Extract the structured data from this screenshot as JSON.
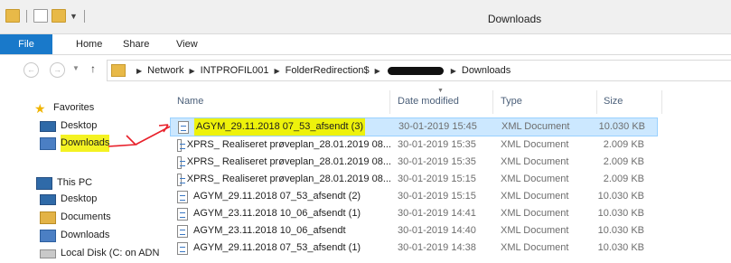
{
  "window": {
    "title": "Downloads"
  },
  "ribbon": {
    "tabs": [
      "File",
      "Home",
      "Share",
      "View"
    ]
  },
  "address": {
    "crumbs": [
      "Network",
      "INTPROFIL001",
      "FolderRedirection$",
      "Downloads"
    ]
  },
  "nav": {
    "favorites": "Favorites",
    "desktop": "Desktop",
    "downloads": "Downloads",
    "this_pc": "This PC",
    "pc_desktop": "Desktop",
    "pc_documents": "Documents",
    "pc_downloads": "Downloads",
    "local_disk": "Local Disk (C: on ADN"
  },
  "columns": {
    "name": "Name",
    "date": "Date modified",
    "type": "Type",
    "size": "Size"
  },
  "files": [
    {
      "name": "AGYM_29.11.2018 07_53_afsendt (3)",
      "date": "30-01-2019 15:45",
      "type": "XML Document",
      "size": "10.030 KB"
    },
    {
      "name": "XPRS_ Realiseret prøveplan_28.01.2019 08...",
      "date": "30-01-2019 15:35",
      "type": "XML Document",
      "size": "2.009 KB"
    },
    {
      "name": "XPRS_ Realiseret prøveplan_28.01.2019 08...",
      "date": "30-01-2019 15:35",
      "type": "XML Document",
      "size": "2.009 KB"
    },
    {
      "name": "XPRS_ Realiseret prøveplan_28.01.2019 08...",
      "date": "30-01-2019 15:15",
      "type": "XML Document",
      "size": "2.009 KB"
    },
    {
      "name": "AGYM_29.11.2018 07_53_afsendt (2)",
      "date": "30-01-2019 15:15",
      "type": "XML Document",
      "size": "10.030 KB"
    },
    {
      "name": "AGYM_23.11.2018 10_06_afsendt (1)",
      "date": "30-01-2019 14:41",
      "type": "XML Document",
      "size": "10.030 KB"
    },
    {
      "name": "AGYM_23.11.2018 10_06_afsendt",
      "date": "30-01-2019 14:40",
      "type": "XML Document",
      "size": "10.030 KB"
    },
    {
      "name": "AGYM_29.11.2018 07_53_afsendt (1)",
      "date": "30-01-2019 14:38",
      "type": "XML Document",
      "size": "10.030 KB"
    }
  ],
  "colors": {
    "accent": "#1979ca",
    "selection": "#cce8ff",
    "highlight": "#f4f222",
    "annotation": "#e8202a"
  }
}
